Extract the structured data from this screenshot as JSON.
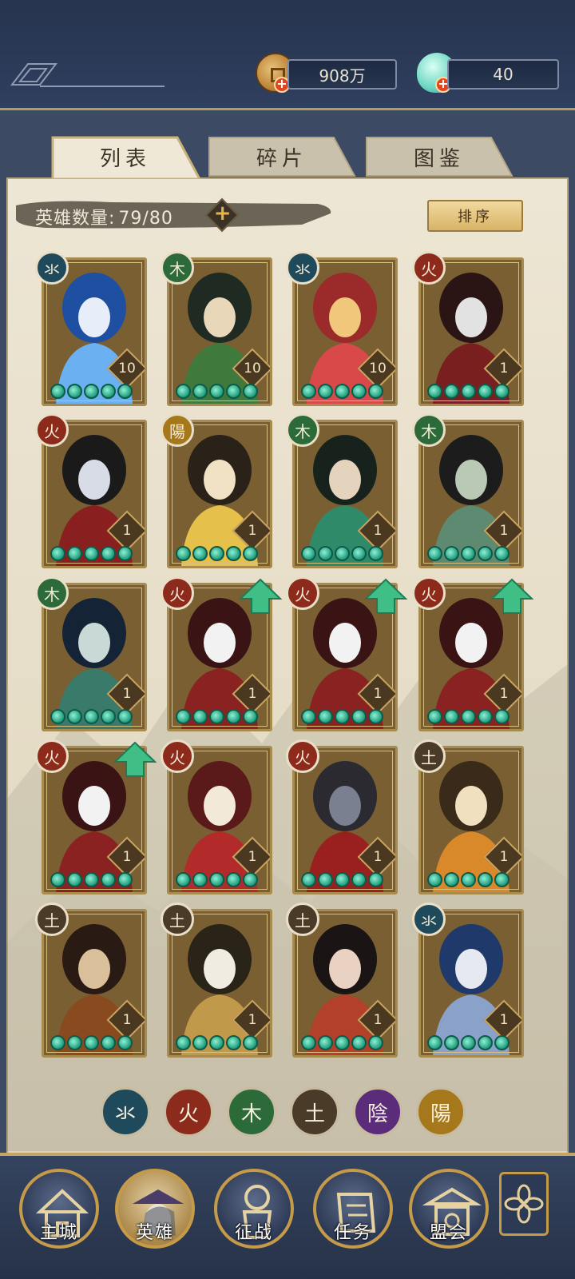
{
  "resources": {
    "coin_amount": "908万",
    "jade_amount": "40"
  },
  "tabs": [
    {
      "label": "列表",
      "active": true
    },
    {
      "label": "碎片",
      "active": false
    },
    {
      "label": "图鉴",
      "active": false
    }
  ],
  "hero_count": {
    "label": "英雄数量:",
    "value": "79/80"
  },
  "sort_label": "排序",
  "element_colors": {
    "water": "#1f4a5c",
    "fire": "#8c2a1c",
    "wood": "#2d6a3a",
    "earth": "#4a3a28",
    "yin": "#5a2c7a",
    "yang": "#a6781c"
  },
  "heroes": [
    {
      "element": "water",
      "glyph": "氺",
      "level": "10",
      "stars": 5,
      "upgrade": false,
      "palette": [
        "#1f4fa0",
        "#6bb1f2",
        "#e7eef9"
      ]
    },
    {
      "element": "wood",
      "glyph": "木",
      "level": "10",
      "stars": 5,
      "upgrade": false,
      "palette": [
        "#1e2a22",
        "#3f7a3c",
        "#e9d7b9"
      ]
    },
    {
      "element": "water",
      "glyph": "氺",
      "level": "10",
      "stars": 5,
      "upgrade": false,
      "palette": [
        "#9b2a2a",
        "#d9494a",
        "#f0c77b"
      ]
    },
    {
      "element": "fire",
      "glyph": "火",
      "level": "1",
      "stars": 5,
      "upgrade": false,
      "palette": [
        "#2a1414",
        "#7a1f1f",
        "#e2e2e2"
      ]
    },
    {
      "element": "fire",
      "glyph": "火",
      "level": "1",
      "stars": 5,
      "upgrade": false,
      "palette": [
        "#1a1a1a",
        "#8a1f1f",
        "#d8dce6"
      ]
    },
    {
      "element": "yang",
      "glyph": "陽",
      "level": "1",
      "stars": 5,
      "upgrade": false,
      "palette": [
        "#2a2218",
        "#e5c04a",
        "#f1e2c5"
      ]
    },
    {
      "element": "wood",
      "glyph": "木",
      "level": "1",
      "stars": 5,
      "upgrade": false,
      "palette": [
        "#18221c",
        "#2f8a6a",
        "#e4d3bd"
      ]
    },
    {
      "element": "wood",
      "glyph": "木",
      "level": "1",
      "stars": 5,
      "upgrade": false,
      "palette": [
        "#1c1c1c",
        "#5e8a72",
        "#b9c9b6"
      ]
    },
    {
      "element": "wood",
      "glyph": "木",
      "level": "1",
      "stars": 5,
      "upgrade": false,
      "palette": [
        "#142436",
        "#3a7a6a",
        "#c9d9d6"
      ]
    },
    {
      "element": "fire",
      "glyph": "火",
      "level": "1",
      "stars": 5,
      "upgrade": true,
      "palette": [
        "#3a1414",
        "#8a2222",
        "#f2f2f2"
      ]
    },
    {
      "element": "fire",
      "glyph": "火",
      "level": "1",
      "stars": 5,
      "upgrade": true,
      "palette": [
        "#3a1414",
        "#8a2222",
        "#f2f2f2"
      ]
    },
    {
      "element": "fire",
      "glyph": "火",
      "level": "1",
      "stars": 5,
      "upgrade": true,
      "palette": [
        "#3a1414",
        "#8a2222",
        "#f2f2f2"
      ]
    },
    {
      "element": "fire",
      "glyph": "火",
      "level": "1",
      "stars": 5,
      "upgrade": true,
      "palette": [
        "#3a1414",
        "#8a2222",
        "#f2f2f2"
      ]
    },
    {
      "element": "fire",
      "glyph": "火",
      "level": "1",
      "stars": 5,
      "upgrade": false,
      "palette": [
        "#5a1a1a",
        "#b22a2a",
        "#f2e9d9"
      ]
    },
    {
      "element": "fire",
      "glyph": "火",
      "level": "1",
      "stars": 5,
      "upgrade": false,
      "palette": [
        "#2a2a30",
        "#9a2020",
        "#7a8090"
      ]
    },
    {
      "element": "earth",
      "glyph": "土",
      "level": "1",
      "stars": 5,
      "upgrade": false,
      "palette": [
        "#3a2a1a",
        "#d9892a",
        "#f0e0c0"
      ]
    },
    {
      "element": "earth",
      "glyph": "土",
      "level": "1",
      "stars": 5,
      "upgrade": false,
      "palette": [
        "#2a1a14",
        "#8a4a1f",
        "#d9c09a"
      ]
    },
    {
      "element": "earth",
      "glyph": "土",
      "level": "1",
      "stars": 5,
      "upgrade": false,
      "palette": [
        "#2a2418",
        "#c09a4a",
        "#f0ece2"
      ]
    },
    {
      "element": "earth",
      "glyph": "土",
      "level": "1",
      "stars": 5,
      "upgrade": false,
      "palette": [
        "#1a1414",
        "#b2402a",
        "#e9d2c2"
      ]
    },
    {
      "element": "water",
      "glyph": "氺",
      "level": "1",
      "stars": 5,
      "upgrade": false,
      "palette": [
        "#1f3a6a",
        "#8aa2c9",
        "#e6e9f0"
      ]
    }
  ],
  "element_filters": [
    {
      "key": "water",
      "glyph": "氺"
    },
    {
      "key": "fire",
      "glyph": "火"
    },
    {
      "key": "wood",
      "glyph": "木"
    },
    {
      "key": "earth",
      "glyph": "土"
    },
    {
      "key": "yin",
      "glyph": "陰"
    },
    {
      "key": "yang",
      "glyph": "陽"
    }
  ],
  "nav": [
    {
      "label": "主城",
      "icon": "city-gate-icon",
      "active": false
    },
    {
      "label": "英雄",
      "icon": "hero-portrait-icon",
      "active": true
    },
    {
      "label": "征战",
      "icon": "battle-flag-icon",
      "active": false
    },
    {
      "label": "任务",
      "icon": "scroll-icon",
      "active": false
    },
    {
      "label": "盟会",
      "icon": "alliance-pavilion-icon",
      "active": false
    }
  ],
  "menu_icon": "flower-menu-icon"
}
